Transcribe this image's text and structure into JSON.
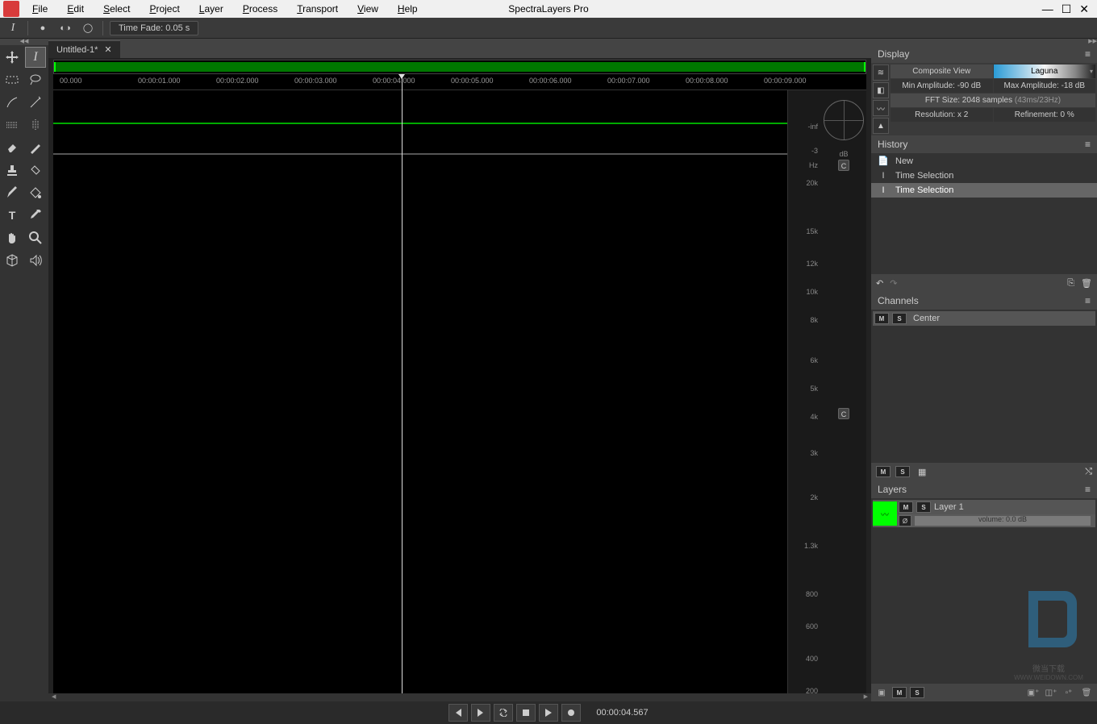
{
  "app": {
    "title": "SpectraLayers Pro"
  },
  "menu": {
    "file": "File",
    "edit": "Edit",
    "select": "Select",
    "project": "Project",
    "layer": "Layer",
    "process": "Process",
    "transport": "Transport",
    "view": "View",
    "help": "Help"
  },
  "toolbar": {
    "time_fade_label": "Time Fade:",
    "time_fade_value": "0.05 s"
  },
  "tab": {
    "title": "Untitled-1*"
  },
  "ruler": {
    "ticks": [
      "00.000",
      "00:00:01.000",
      "00:00:02.000",
      "00:00:03.000",
      "00:00:04.000",
      "00:00:05.000",
      "00:00:06.000",
      "00:00:07.000",
      "00:00:08.000",
      "00:00:09.000"
    ]
  },
  "freq": {
    "hz": "Hz",
    "inf": "-inf",
    "m3": "-3",
    "vals": [
      "20k",
      "15k",
      "12k",
      "10k",
      "8k",
      "6k",
      "5k",
      "4k",
      "3k",
      "2k",
      "1.3k",
      "800",
      "600",
      "400",
      "200"
    ]
  },
  "scope": {
    "db": "dB",
    "channel": "C"
  },
  "display": {
    "title": "Display",
    "composite": "Composite View",
    "laguna": "Laguna",
    "min_amp": "Min Amplitude: -90 dB",
    "max_amp": "Max Amplitude: -18 dB",
    "fft": "FFT Size: 2048 samples",
    "fft_detail": "(43ms/23Hz)",
    "resolution": "Resolution: x 2",
    "refinement": "Refinement: 0 %"
  },
  "history": {
    "title": "History",
    "items": [
      {
        "icon": "📄",
        "label": "New"
      },
      {
        "icon": "I",
        "label": "Time Selection"
      },
      {
        "icon": "I",
        "label": "Time Selection"
      }
    ]
  },
  "channels": {
    "title": "Channels",
    "m": "M",
    "s": "S",
    "center": "Center"
  },
  "layers": {
    "title": "Layers",
    "m": "M",
    "s": "S",
    "name": "Layer 1",
    "volume": "volume: 0.0 dB",
    "phase": "Ø"
  },
  "transport": {
    "time": "00:00:04.567"
  },
  "watermark": {
    "text": "微当下载",
    "url": "WWW.WEIDOWN.COM"
  }
}
